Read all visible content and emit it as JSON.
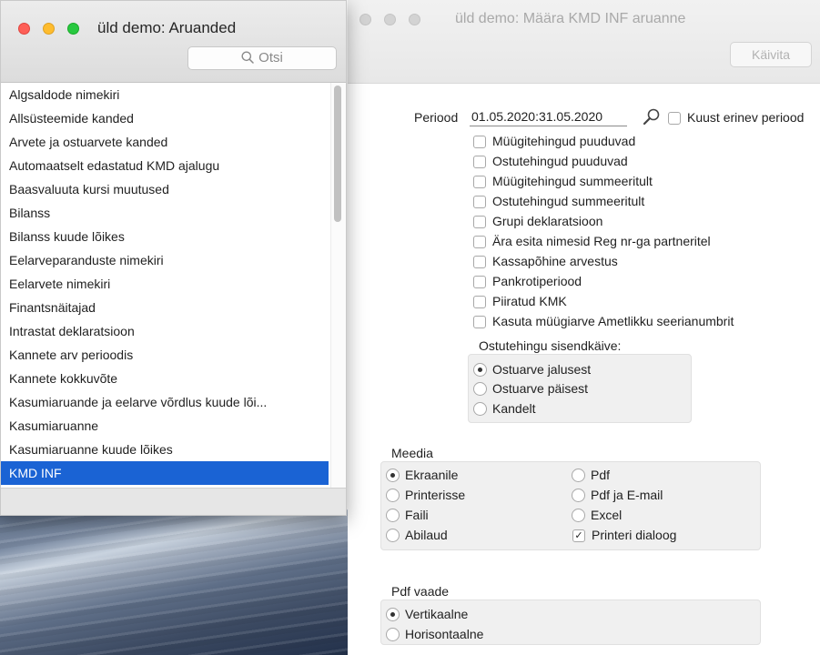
{
  "colors": {
    "selection": "#1a63d4",
    "close": "#fe5f57",
    "minimize": "#febc2e",
    "zoom": "#28c840"
  },
  "report_window": {
    "title": "üld demo: Aruanded",
    "search_placeholder": "Otsi",
    "search_icon": "magnifier-icon",
    "items": [
      "Algsaldode nimekiri",
      "Allsüsteemide kanded",
      "Arvete ja ostuarvete kanded",
      "Automaatselt edastatud KMD ajalugu",
      "Baasvaluuta kursi muutused",
      "Bilanss",
      "Bilanss kuude lõikes",
      "Eelarveparanduste nimekiri",
      "Eelarvete nimekiri",
      "Finantsnäitajad",
      "Intrastat deklaratsioon",
      "Kannete arv perioodis",
      "Kannete kokkuvõte",
      "Kasumiaruande ja eelarve võrdlus kuude lõi...",
      "Kasumiaruanne",
      "Kasumiaruanne kuude lõikes",
      "KMD INF"
    ],
    "selected_item": "KMD INF"
  },
  "spec_window": {
    "title": "üld demo: Määra KMD INF aruanne",
    "run_button": "Käivita",
    "period_label": "Periood",
    "period_value": "01.05.2020:31.05.2020",
    "period_lookup_icon": "magnifier-icon",
    "custom_period_label": "Kuust erinev periood",
    "options": [
      {
        "label": "Müügitehingud puuduvad",
        "checked": false
      },
      {
        "label": "Ostutehingud puuduvad",
        "checked": false
      },
      {
        "label": "Müügitehingud summeeritult",
        "checked": false
      },
      {
        "label": "Ostutehingud summeeritult",
        "checked": false
      },
      {
        "label": "Grupi deklaratsioon",
        "checked": false
      },
      {
        "label": "Ära esita nimesid Reg nr-ga partneritel",
        "checked": false
      },
      {
        "label": "Kassapõhine arvestus",
        "checked": false
      },
      {
        "label": "Pankrotiperiood",
        "checked": false
      },
      {
        "label": "Piiratud KMK",
        "checked": false
      },
      {
        "label": "Kasuta müügiarve Ametlikku seerianumbrit",
        "checked": false
      }
    ],
    "purchase_source": {
      "label": "Ostutehingu sisendkäive:",
      "options": [
        "Ostuarve jalusest",
        "Ostuarve päisest",
        "Kandelt"
      ],
      "selected": "Ostuarve jalusest"
    },
    "media": {
      "label": "Meedia",
      "left": [
        "Ekraanile",
        "Printerisse",
        "Faili",
        "Abilaud"
      ],
      "right": [
        "Pdf",
        "Pdf ja E-mail",
        "Excel"
      ],
      "selected": "Ekraanile",
      "print_dialog_label": "Printeri dialoog",
      "print_dialog_checked": true
    },
    "pdf_view": {
      "label": "Pdf vaade",
      "options": [
        "Vertikaalne",
        "Horisontaalne"
      ],
      "selected": "Vertikaalne"
    }
  }
}
